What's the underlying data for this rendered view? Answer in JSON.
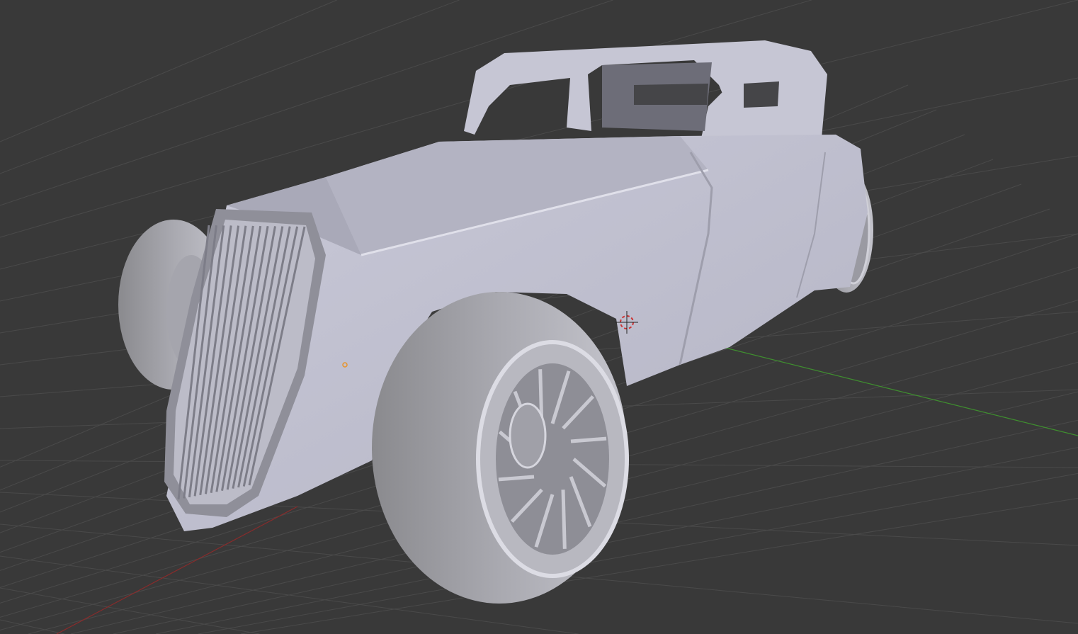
{
  "viewport": {
    "background": "#393939",
    "grid_color": "#4a4a4a",
    "x_axis_color": "#8a2b2b",
    "y_axis_color": "#3f8f2f",
    "model_color": "#c8c8d6",
    "origin_color": "#e8932a",
    "icons": [
      "3d-cursor-icon",
      "object-origin-icon"
    ]
  }
}
